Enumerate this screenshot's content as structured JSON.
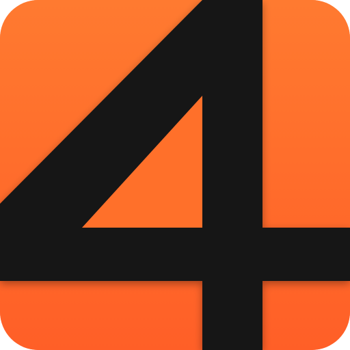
{
  "icon": {
    "name": "four-app-icon",
    "glyph": "4",
    "colors": {
      "background_top": "#ff7a30",
      "background_bottom": "#ff5f27",
      "glyph": "#141414"
    }
  }
}
